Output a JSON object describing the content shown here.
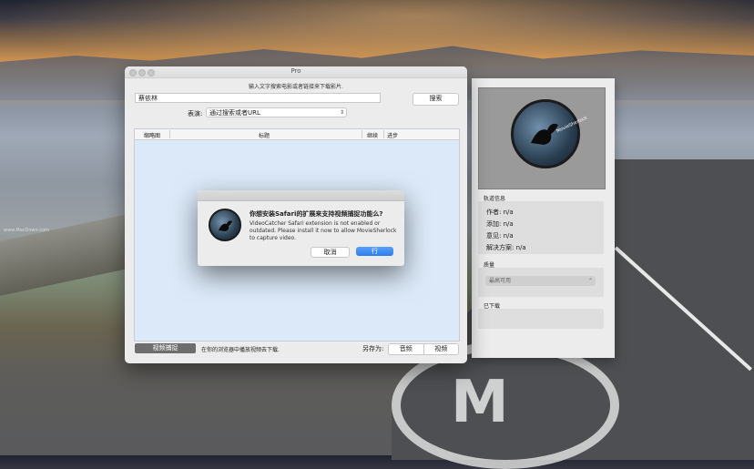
{
  "window": {
    "title": "Pro"
  },
  "search": {
    "hint": "输入文字搜索电影或者链接来下载影片.",
    "value": "蔡依林",
    "button": "搜索"
  },
  "performance": {
    "label": "表演:",
    "selected": "通过搜索或者URL"
  },
  "table": {
    "columns": [
      "缩略图",
      "标题",
      "继续",
      "进步"
    ]
  },
  "bottom": {
    "capture_button": "视频捕捉",
    "capture_text": "在你的浏览器中播放视频去下载.",
    "save_as_label": "另存为:",
    "save_options": [
      "音频",
      "视频"
    ]
  },
  "panel": {
    "logo_text": "MovieSherlock",
    "track_info_title": "轨道信息",
    "info": [
      {
        "label": "作者:",
        "value": "n/a"
      },
      {
        "label": "添加:",
        "value": "n/a"
      },
      {
        "label": "意见:",
        "value": "n/a"
      },
      {
        "label": "解决方案:",
        "value": "n/a"
      }
    ],
    "quality_title": "质量",
    "quality_selected": "最高可用",
    "downloaded_title": "已下载"
  },
  "dialog": {
    "title": "你想安装Safari的扩展来支持视频捕捉功能么?",
    "message": "VideoCatcher Safari extension is not enabled or outdated. Please install it now to allow MovieSherlock to capture video.",
    "cancel": "取消",
    "confirm": "行"
  },
  "desktop": {
    "watermark": "www.MacDown.com"
  },
  "colors": {
    "accent": "#2c7cf0",
    "table_bg": "#dbe9f8"
  }
}
